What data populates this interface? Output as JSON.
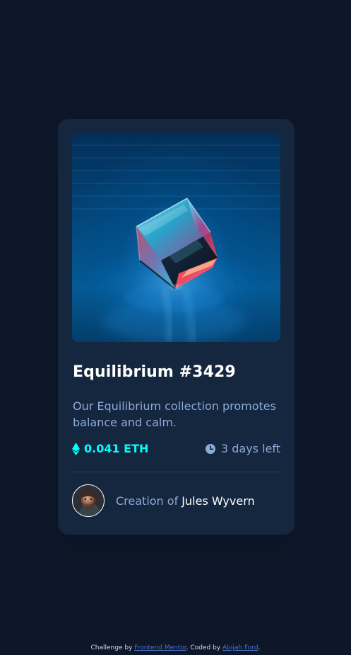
{
  "card": {
    "title": "Equilibrium #3429",
    "description": "Our Equilibrium collection promotes balance and calm.",
    "price": "0.041 ETH",
    "time_left": "3 days left",
    "creator_prefix": "Creation of ",
    "creator_name": "Jules Wyvern"
  },
  "footer": {
    "challenge_prefix": "Challenge by ",
    "challenge_link": "Frontend Mentor",
    "coded_by_prefix": ". Coded by ",
    "author_link": "Abijah Ford",
    "suffix": "."
  },
  "icons": {
    "price": "ethereum-icon",
    "time": "clock-icon"
  },
  "colors": {
    "background": "#0d1729",
    "card": "#15263f",
    "accent": "#00fff8",
    "muted_text": "#8bacd9",
    "white": "#ffffff"
  }
}
